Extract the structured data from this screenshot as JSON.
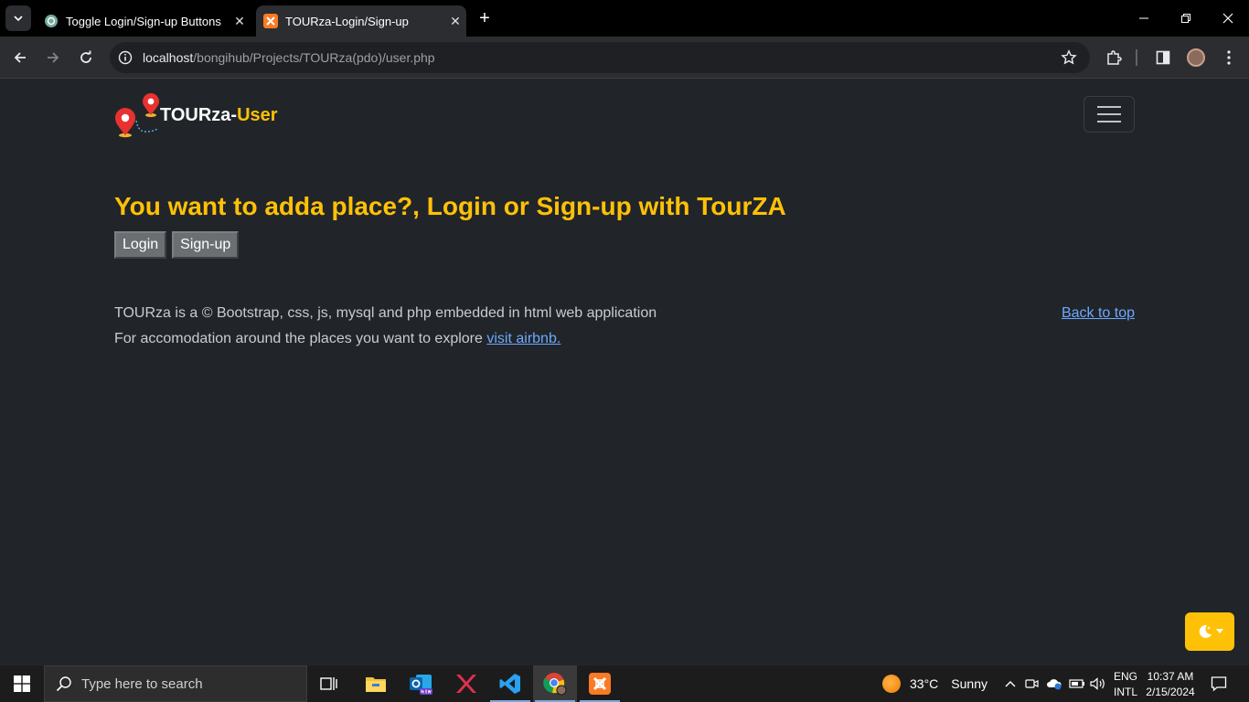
{
  "browser": {
    "tabs": [
      {
        "title": "Toggle Login/Sign-up Buttons",
        "active": false
      },
      {
        "title": "TOURza-Login/Sign-up",
        "active": true
      }
    ],
    "url_host": "localhost",
    "url_path": "/bongihub/Projects/TOURza(pdo)/user.php"
  },
  "navbar": {
    "brand_main": "TOURza-",
    "brand_accent": "User"
  },
  "main": {
    "heading": "You want to adda place?, Login or Sign-up with TourZA",
    "login_label": "Login",
    "signup_label": "Sign-up"
  },
  "footer": {
    "line1": "TOURza is a © Bootstrap, css, js, mysql and php embedded in html web application",
    "line2_text": "For accomodation around the places you want to explore ",
    "line2_link": "visit airbnb.",
    "back_to_top": "Back to top"
  },
  "colors": {
    "accent": "#ffc107",
    "background": "#212529",
    "link": "#6ea8fe"
  },
  "taskbar": {
    "search_placeholder": "Type here to search",
    "weather_temp": "33°C",
    "weather_desc": "Sunny",
    "lang_line1": "ENG",
    "lang_line2": "INTL",
    "time": "10:37 AM",
    "date": "2/15/2024"
  }
}
